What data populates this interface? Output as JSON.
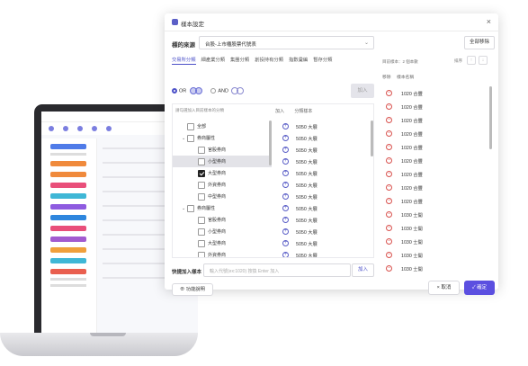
{
  "dialog": {
    "title": "樣本設定",
    "close": "×"
  },
  "source": {
    "label": "標的來源",
    "value": "台股-上市櫃股票代號表",
    "clear_all": "全部移除"
  },
  "tabs": [
    "交易所分類",
    "細產業分類",
    "集團分類",
    "創投持有分類",
    "指數彙編",
    "暫存分類"
  ],
  "logic": {
    "or_label": "OR",
    "and_label": "AND",
    "add_label": "加入"
  },
  "left": {
    "hint": "請勾選加入目前樣本的分類",
    "tree": [
      {
        "label": "全部",
        "level": 0,
        "checked": false,
        "caret": ""
      },
      {
        "label": "券商屬性",
        "level": 0,
        "checked": false,
        "caret": "v"
      },
      {
        "label": "官股券商",
        "level": 1,
        "checked": false,
        "caret": ""
      },
      {
        "label": "小型券商",
        "level": 1,
        "checked": false,
        "caret": "",
        "selected": true
      },
      {
        "label": "大型券商",
        "level": 1,
        "checked": true,
        "caret": ""
      },
      {
        "label": "外資券商",
        "level": 1,
        "checked": false,
        "caret": ""
      },
      {
        "label": "中型券商",
        "level": 1,
        "checked": false,
        "caret": ""
      },
      {
        "label": "券商屬性",
        "level": 0,
        "checked": false,
        "caret": "v"
      },
      {
        "label": "官股券商",
        "level": 1,
        "checked": false,
        "caret": ""
      },
      {
        "label": "小型券商",
        "level": 1,
        "checked": false,
        "caret": ""
      },
      {
        "label": "大型券商",
        "level": 1,
        "checked": false,
        "caret": ""
      },
      {
        "label": "外資券商",
        "level": 1,
        "checked": false,
        "caret": ""
      }
    ],
    "mid_head": {
      "add": "加入",
      "name": "分類樣本"
    },
    "mid_rows": [
      "5050 大展",
      "5050 大展",
      "5050 大展",
      "5050 大展",
      "5050 大展",
      "5050 大展",
      "5050 大展",
      "5050 大展",
      "5050 大展",
      "5050 大展",
      "5050 大展",
      "5050 大展"
    ]
  },
  "quick": {
    "label": "快捷加入樣本",
    "placeholder": "輸入代號(ex:1020) 按換 Enter 加入",
    "add": "加入"
  },
  "help": "功能說明",
  "right": {
    "count": "目前樣本：2 個本數",
    "sort": "排序",
    "up": "↑",
    "down": "↓",
    "head": {
      "remove": "移除",
      "name": "樣本名稱"
    },
    "rows": [
      "1020 合豐",
      "1020 合豐",
      "1020 合豐",
      "1020 合豐",
      "1020 合豐",
      "1020 合豐",
      "1020 合豐",
      "1020 合豐",
      "1020 合豐",
      "1030 士開",
      "1030 士開",
      "1030 士開",
      "1030 士開",
      "1030 士開"
    ]
  },
  "footer": {
    "cancel": "取消",
    "ok": "確定"
  },
  "colors": {
    "accent": "#5b4fe0",
    "remove": "#d9534f"
  }
}
